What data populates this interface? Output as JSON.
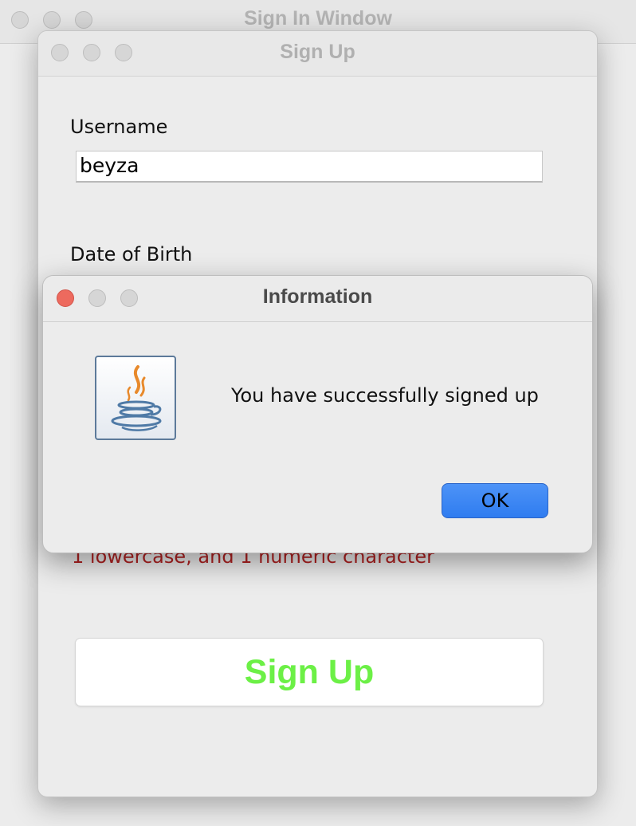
{
  "background_window": {
    "title": "Sign In Window"
  },
  "signup_window": {
    "title": "Sign Up",
    "username_label": "Username",
    "username_value": "beyza",
    "dob_label": "Date of Birth",
    "password_hint_visible": "1 lowercase, and 1 numeric character",
    "signup_button": "Sign Up",
    "signup_button_color": "#6cf046",
    "hint_color": "#b22222"
  },
  "info_dialog": {
    "title": "Information",
    "icon": "java-icon",
    "message": "You have successfully signed up",
    "ok_button": "OK",
    "ok_color": "#2f7cf0"
  },
  "colors": {
    "close_red": "#ed6a5e",
    "window_bg": "#ececec"
  }
}
